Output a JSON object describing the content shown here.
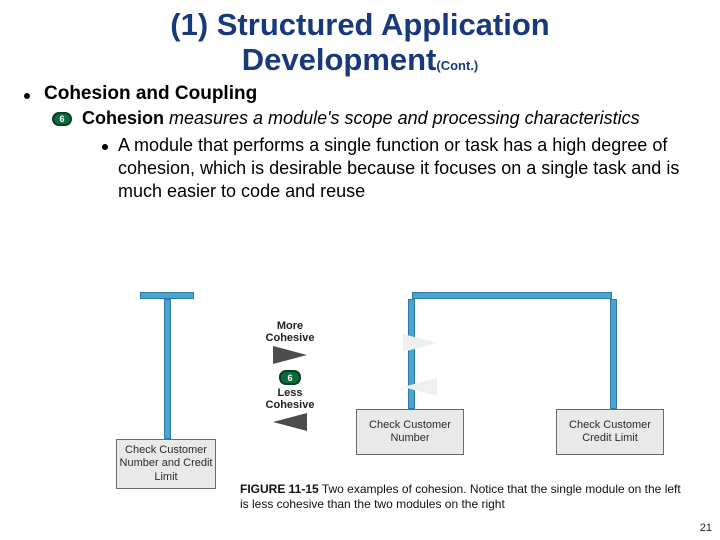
{
  "title_line1": "(1) Structured Application",
  "title_line2": "Development",
  "title_cont": "(Cont.)",
  "bullet1": "Cohesion and Coupling",
  "badge6": "6",
  "sub1_term": "Cohesion",
  "sub1_rest": " measures a module's scope and processing characteristics",
  "sub2": "A module that performs a single function or task has a high degree of cohesion, which is desirable because it focuses on a single task and is much easier to code and reuse",
  "figure": {
    "more_label": "More\nCohesive",
    "less_label": "Less\nCohesive",
    "badge": "6",
    "box_left": "Check Customer Number and Credit Limit",
    "box_r1": "Check Customer Number",
    "box_r2": "Check Customer Credit Limit"
  },
  "caption_num": "FIGURE 11-15",
  "caption_text": " Two examples of cohesion. Notice that the single module on the left is less cohesive than the two modules on the right",
  "page_number": "21"
}
